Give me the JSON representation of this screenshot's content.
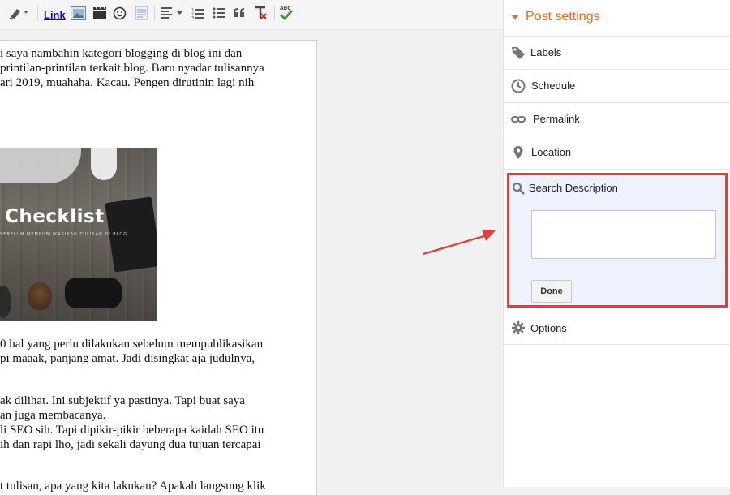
{
  "toolbar": {
    "link_label": "Link"
  },
  "editor": {
    "paragraphs": [
      {
        "text": "i saya nambahin kategori blogging di blog ini dan"
      },
      {
        "text": "printilan-printilan terkait blog. Baru nyadar tulisannya"
      },
      {
        "text": "ari 2019, muahaha. Kacau. Pengen dirutinin lagi nih"
      },
      {
        "text": "0 hal yang perlu dilakukan sebelum mempublikasikan"
      },
      {
        "text": "pi maaak, panjang amat. Jadi disingkat aja judulnya,"
      },
      {
        "text": "ak dilihat. Ini subjektif ya pastinya. Tapi buat saya"
      },
      {
        "text": "an juga membacanya."
      },
      {
        "text": "li SEO sih. Tapi dipikir-pikir beberapa kaidah SEO itu"
      },
      {
        "text": "ih dan rapi lho, jadi sekali dayung dua tujuan tercapai"
      },
      {
        "text": "t tulisan, apa yang kita lakukan? Apakah langsung klik"
      }
    ],
    "image": {
      "title": "Checklist",
      "subtitle": "SEBELUM MEMPUBLIKASIKAN TULISAN DI BLOG"
    }
  },
  "sidebar": {
    "header": "Post settings",
    "accent": "#f26522",
    "items": [
      {
        "label": "Labels",
        "icon": "tag-icon"
      },
      {
        "label": "Schedule",
        "icon": "clock-icon"
      },
      {
        "label": "Permalink",
        "icon": "link-icon"
      },
      {
        "label": "Location",
        "icon": "location-pin-icon"
      }
    ],
    "search_description": {
      "label": "Search Description",
      "value": "",
      "done_label": "Done",
      "highlight_color": "#e0403a"
    },
    "options": {
      "label": "Options",
      "icon": "gear-icon"
    }
  }
}
